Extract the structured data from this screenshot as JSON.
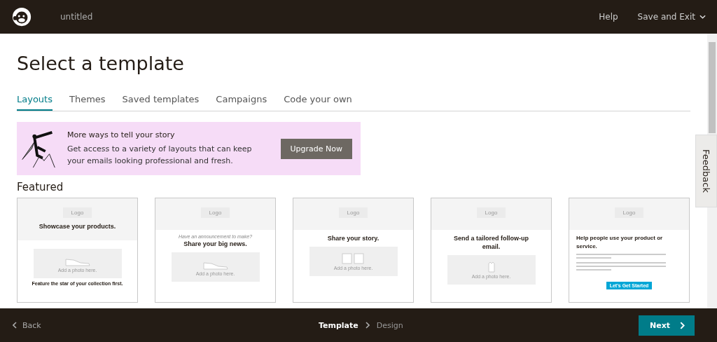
{
  "top_bar": {
    "title": "untitled",
    "links": [
      "Help",
      "Save and Exit"
    ]
  },
  "heading": "Select a template",
  "tabs": [
    {
      "label": "Layouts",
      "selected": true
    },
    {
      "label": "Themes",
      "selected": false
    },
    {
      "label": "Saved templates",
      "selected": false
    },
    {
      "label": "Campaigns",
      "selected": false
    },
    {
      "label": "Code your own",
      "selected": false
    }
  ],
  "banner": {
    "title": "More ways to tell your story",
    "text": "Get access to a variety of layouts that can keep your emails looking professional and fresh.",
    "button": "Upgrade Now"
  },
  "section_title": "Featured",
  "templates": [
    {
      "kind": "header_title",
      "logo": "Logo",
      "title": "Showcase your products.",
      "photo_caption": "Add a photo here.",
      "feature_title": "Feature the star of your collection first."
    },
    {
      "kind": "centered",
      "logo": "Logo",
      "pre_title": "Have an announcement to make?",
      "title": "Share your big news.",
      "photo_caption": "Add a photo here."
    },
    {
      "kind": "centered",
      "logo": "Logo",
      "title": "Share your story.",
      "photo_caption": "Add a photo here."
    },
    {
      "kind": "centered",
      "logo": "Logo",
      "title": "Send a tailored follow-up email.",
      "photo_caption": "Add a photo here."
    },
    {
      "kind": "left",
      "logo": "Logo",
      "title": "Help people use your product or service.",
      "button": "Let's Get Started"
    }
  ],
  "feedback": "Feedback",
  "bottom_bar": {
    "back": "Back",
    "steps": [
      {
        "label": "Template",
        "selected": true
      },
      {
        "label": "Design",
        "selected": false
      }
    ],
    "next": "Next"
  }
}
